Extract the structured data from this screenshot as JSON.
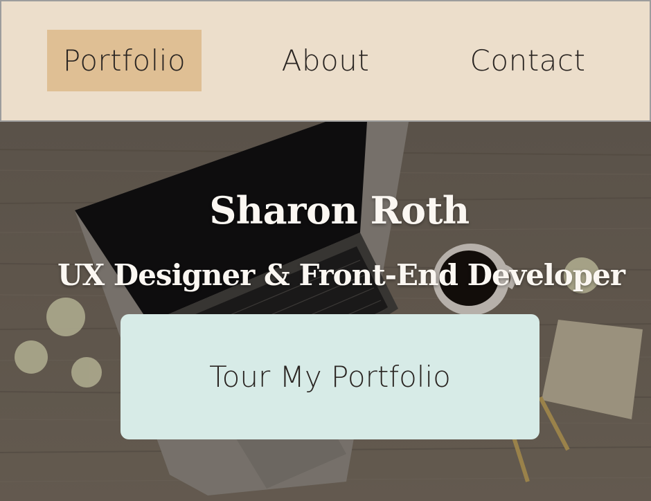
{
  "nav": {
    "items": [
      {
        "label": "Portfolio",
        "active": true
      },
      {
        "label": "About",
        "active": false
      },
      {
        "label": "Contact",
        "active": false
      }
    ],
    "active_color": "#dfbf94",
    "background_color": "#ecdecb"
  },
  "hero": {
    "title": "Sharon Roth",
    "subtitle": "UX Designer & Front-End Developer",
    "cta_label": "Tour My Portfolio",
    "cta_color": "#d7ebe7"
  }
}
